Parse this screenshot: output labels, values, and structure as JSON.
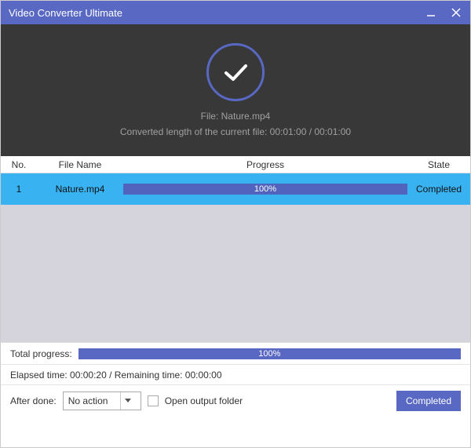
{
  "titlebar": {
    "title": "Video Converter Ultimate"
  },
  "status": {
    "file_label": "File: Nature.mp4",
    "converted_label": "Converted length of the current file: 00:01:00 / 00:01:00"
  },
  "table": {
    "headers": {
      "no": "No.",
      "name": "File Name",
      "progress": "Progress",
      "state": "State"
    },
    "rows": [
      {
        "no": "1",
        "name": "Nature.mp4",
        "progress": "100%",
        "state": "Completed"
      }
    ]
  },
  "total": {
    "label": "Total progress:",
    "percent": "100%"
  },
  "timing": {
    "text": "Elapsed time: 00:00:20 / Remaining time: 00:00:00"
  },
  "footer": {
    "after_label": "After done:",
    "dropdown_value": "No action",
    "checkbox_label": "Open output folder",
    "button_label": "Completed"
  }
}
